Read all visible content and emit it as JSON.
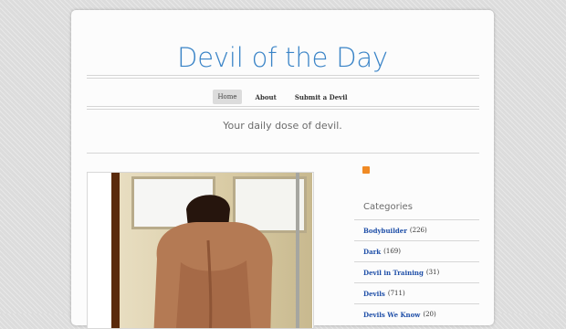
{
  "site": {
    "title": "Devil of the Day",
    "tagline": "Your daily dose of devil."
  },
  "nav": {
    "items": [
      {
        "label": "Home",
        "active": true
      },
      {
        "label": "About",
        "active": false
      },
      {
        "label": "Submit a Devil",
        "active": false
      }
    ]
  },
  "post": {
    "image_icon": "photo-of-man"
  },
  "sidebar": {
    "feed_icon": "rss-icon",
    "categories_heading": "Categories",
    "categories": [
      {
        "label": "Bodybuilder",
        "count": "(226)"
      },
      {
        "label": "Dark",
        "count": "(169)"
      },
      {
        "label": "Devil in Training",
        "count": "(31)"
      },
      {
        "label": "Devils",
        "count": "(711)"
      },
      {
        "label": "Devils We Know",
        "count": "(20)"
      }
    ]
  },
  "colors": {
    "title": "#3a84c7",
    "link": "#1f4fa8",
    "rss": "#f08a24"
  }
}
